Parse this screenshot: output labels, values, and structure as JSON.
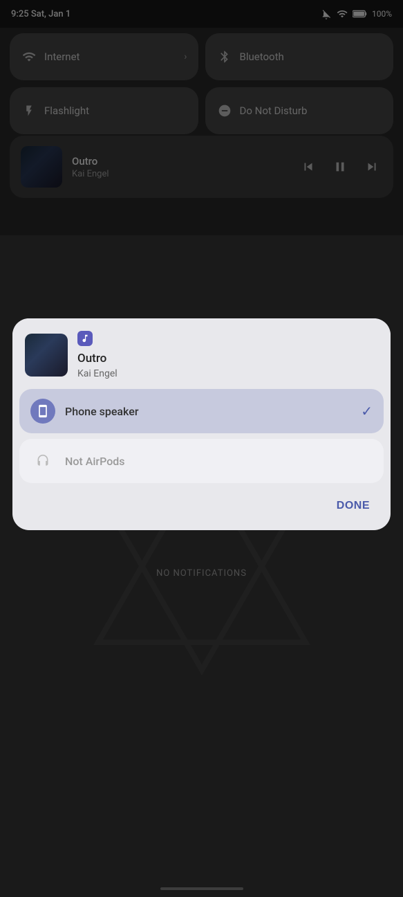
{
  "statusBar": {
    "time": "9:25 Sat, Jan 1",
    "battery": "100%"
  },
  "tiles": {
    "row1": [
      {
        "id": "internet",
        "label": "Internet",
        "active": false,
        "hasChevron": true
      },
      {
        "id": "bluetooth",
        "label": "Bluetooth",
        "active": false,
        "hasChevron": false
      }
    ],
    "row2": [
      {
        "id": "flashlight",
        "label": "Flashlight",
        "active": false,
        "hasChevron": false
      },
      {
        "id": "dnd",
        "label": "Do Not Disturb",
        "active": false,
        "hasChevron": false
      }
    ]
  },
  "mediaPlayer": {
    "title": "Outro",
    "artist": "Kai Engel"
  },
  "modal": {
    "songTitle": "Outro",
    "songArtist": "Kai Engel",
    "audioOptions": [
      {
        "id": "phone-speaker",
        "label": "Phone speaker",
        "selected": true
      },
      {
        "id": "not-airpods",
        "label": "Not AirPods",
        "selected": false
      }
    ],
    "doneLabel": "DONE"
  },
  "noNotifications": "NO NOTIFICATIONS"
}
